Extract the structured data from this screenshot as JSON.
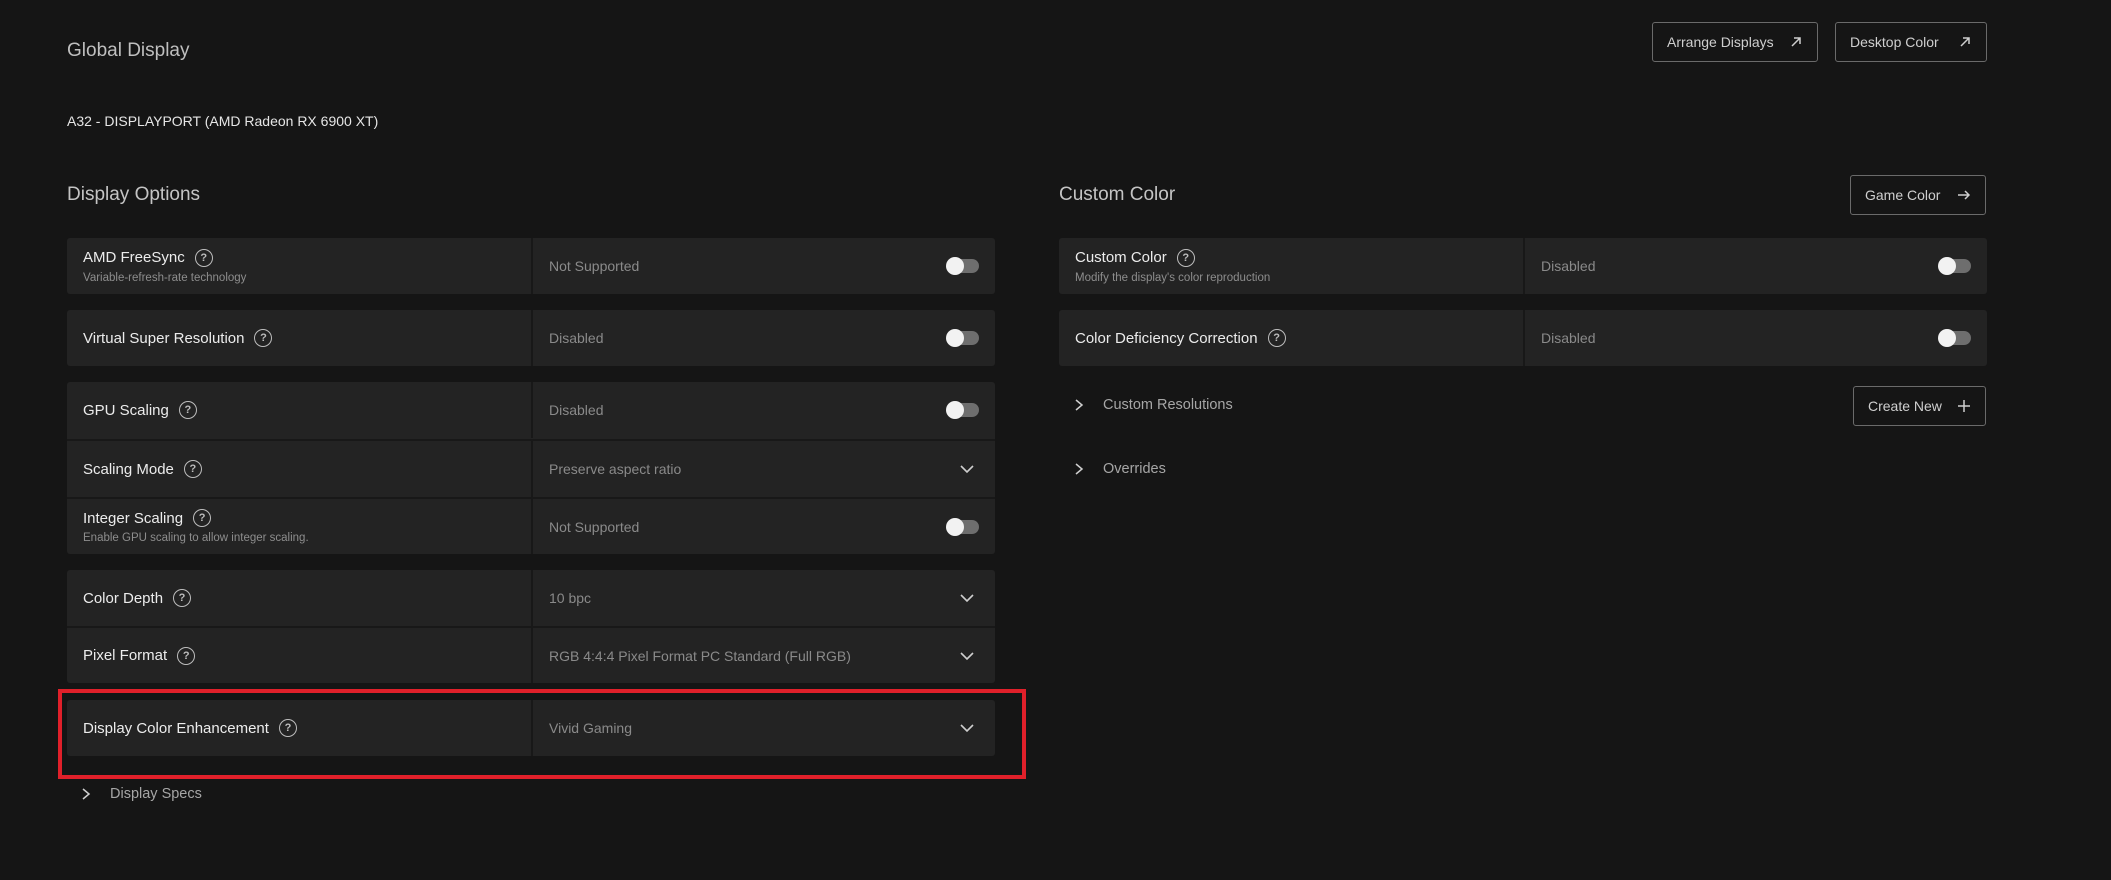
{
  "header": {
    "title": "Global Display",
    "display_name": "A32 - DISPLAYPORT (AMD Radeon RX 6900 XT)",
    "arrange_displays": "Arrange Displays",
    "desktop_color": "Desktop Color"
  },
  "display_options": {
    "title": "Display Options",
    "freesync": {
      "label": "AMD FreeSync",
      "desc": "Variable-refresh-rate technology",
      "value": "Not Supported"
    },
    "vsr": {
      "label": "Virtual Super Resolution",
      "value": "Disabled"
    },
    "gpu_scaling": {
      "label": "GPU Scaling",
      "value": "Disabled"
    },
    "scaling_mode": {
      "label": "Scaling Mode",
      "value": "Preserve aspect ratio"
    },
    "integer_scaling": {
      "label": "Integer Scaling",
      "desc": "Enable GPU scaling to allow integer scaling.",
      "value": "Not Supported"
    },
    "color_depth": {
      "label": "Color Depth",
      "value": "10 bpc"
    },
    "pixel_format": {
      "label": "Pixel Format",
      "value": "RGB 4:4:4 Pixel Format PC Standard (Full RGB)"
    },
    "color_enhancement": {
      "label": "Display Color Enhancement",
      "value": "Vivid Gaming"
    },
    "display_specs": "Display Specs"
  },
  "custom_color": {
    "title": "Custom Color",
    "game_color": "Game Color",
    "custom_color_row": {
      "label": "Custom Color",
      "desc": "Modify the display's color reproduction",
      "value": "Disabled"
    },
    "deficiency": {
      "label": "Color Deficiency Correction",
      "value": "Disabled"
    },
    "custom_resolutions": "Custom Resolutions",
    "create_new": "Create New",
    "overrides": "Overrides"
  },
  "help_symbol": "?",
  "colors": {
    "highlight": "#e0202a",
    "background": "#151515",
    "card": "#232323"
  }
}
